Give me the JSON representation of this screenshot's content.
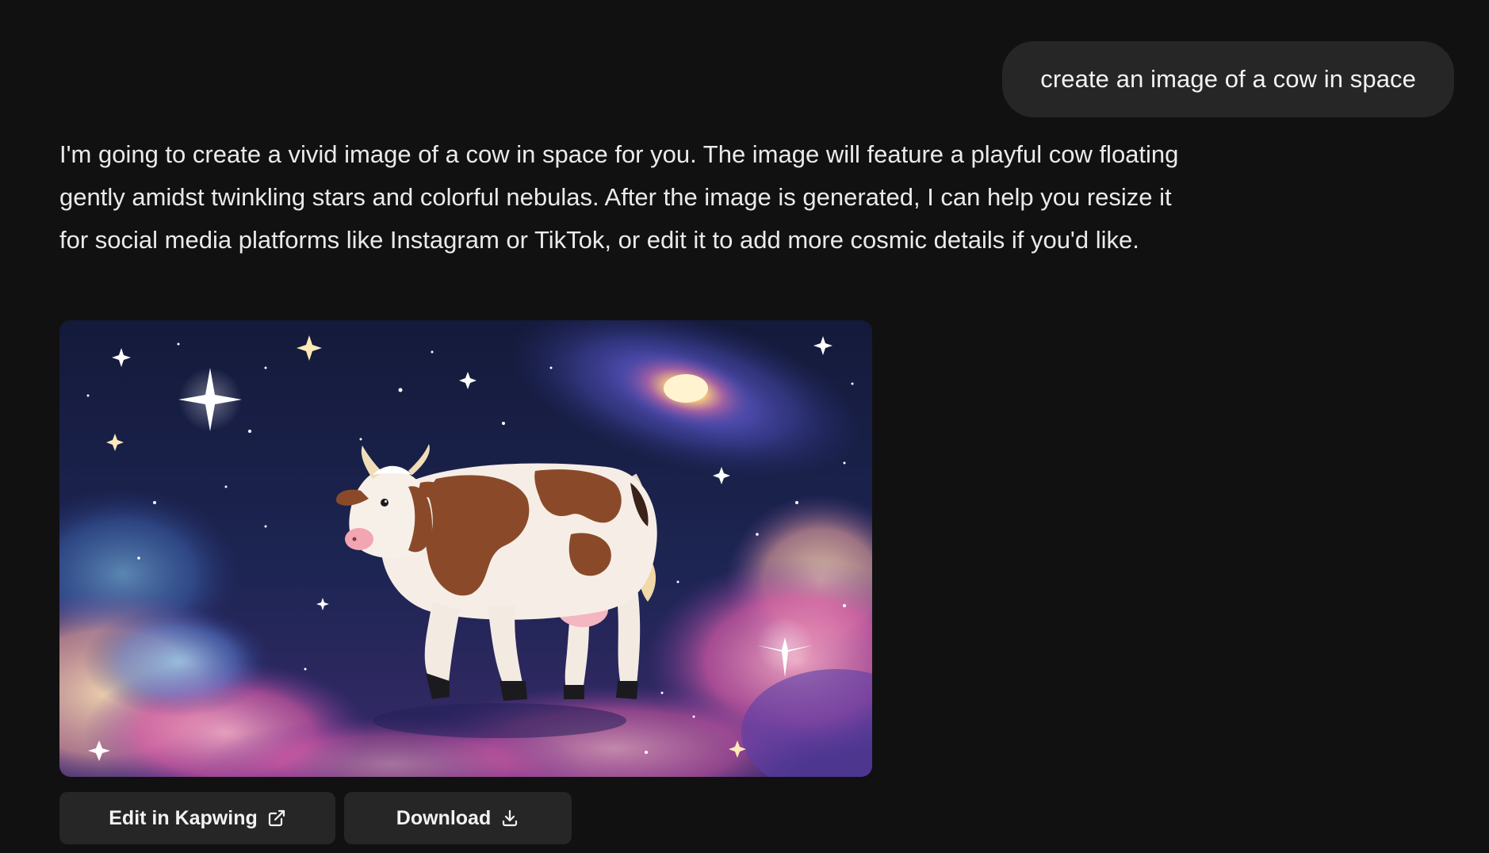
{
  "conversation": {
    "user_message": "create an image of a cow in space",
    "assistant_message": "I'm going to create a vivid image of a cow in space for you. The image will feature a playful cow floating gently amidst twinkling stars and colorful nebulas. After the image is generated, I can help you resize it for social media platforms like Instagram or TikTok, or edit it to add more cosmic details if you'd like."
  },
  "actions": {
    "edit_label": "Edit in Kapwing",
    "edit_icon": "external-link-icon",
    "download_label": "Download",
    "download_icon": "download-icon"
  },
  "colors": {
    "background": "#111111",
    "bubble": "#262626",
    "button": "#262626",
    "text": "#eaeaea"
  }
}
